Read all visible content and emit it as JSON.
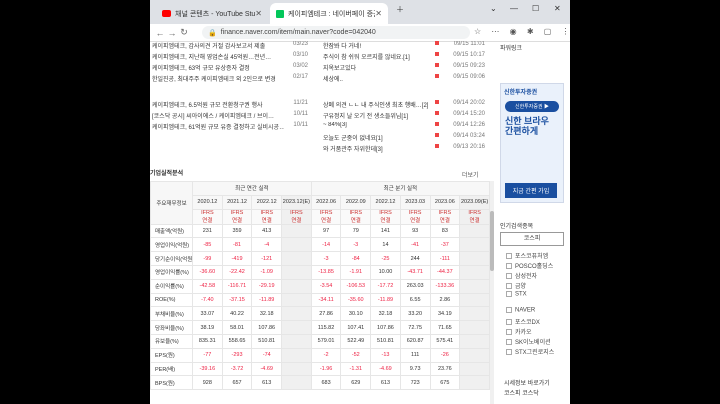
{
  "tabs": [
    {
      "label": "채널 콘텐츠 - YouTube Studio",
      "icon": "youtube-icon"
    },
    {
      "label": "케이피엠테크 : 네이버페이 증권",
      "icon": "naver-icon"
    }
  ],
  "address": "finance.naver.com/item/main.naver?code=042040",
  "news_left": [
    {
      "title": "케이피엠테크, 감사의견 거절 감사보고서 제출",
      "date": "03/23"
    },
    {
      "title": "케이피엠테크, 지난해 영업손실 45억원…전년…",
      "date": "03/10"
    },
    {
      "title": "케이피엠테크, 63억 규모 유상증자 결정",
      "date": "03/02"
    },
    {
      "title": "한일진공, 최대주주 케이피엠테크 외 2인으로 변경",
      "date": "02/17"
    },
    {
      "title": "케이피엠테크, 6.5억원 규모 전환청구권 행사",
      "date": "11/21"
    },
    {
      "title": "[코스닥 공시] 씨아이에스 / 케이피엠테크 / 브이…",
      "date": "10/11"
    },
    {
      "title": "케이피엠테크, 61억원 규모 유증 결정하고 실비시공…",
      "date": "10/11"
    }
  ],
  "news_right": [
    {
      "title": "한잠봐 다 거네!",
      "date": "09/15 11:01"
    },
    {
      "title": "주식이 참 쉬워 오르지를 않네요.[1]",
      "date": "09/15 10:17"
    },
    {
      "title": "지옥보고있다",
      "date": "09/15 09:23"
    },
    {
      "title": "세상에..",
      "date": "09/15 09:06"
    },
    {
      "title": "상폐 의견 ㄴㄴ 내 주식인생 최초 행배…[2]",
      "date": "09/14 20:02"
    },
    {
      "title": "구유정지 날 오기 전 생소들위님[1]",
      "date": "09/14 15:20"
    },
    {
      "title": "~ 84%[3]",
      "date": "09/14 12:26"
    },
    {
      "title": "오늘도 군중이 없네요[1]",
      "date": "09/14 03:24"
    },
    {
      "title": "와 거품관주 자위한데[3]",
      "date": "09/13 20:16"
    }
  ],
  "fin": {
    "title": "기업실적분석",
    "more": "더보기",
    "group_annual": "최근 연간 실적",
    "group_quarter": "최근 분기 실적",
    "row_header": "주요재무정보",
    "periods": [
      "2020.12",
      "2021.12",
      "2022.12",
      "2023.12(E)",
      "2022.06",
      "2022.09",
      "2022.12",
      "2023.03",
      "2023.06",
      "2023.09(E)"
    ],
    "ifrs": "IFRS",
    "ifrs_sub": "연결",
    "rows": [
      {
        "label": "매출액(억원)",
        "values": [
          "231",
          "359",
          "413",
          "",
          "97",
          "79",
          "141",
          "93",
          "83",
          ""
        ]
      },
      {
        "label": "영업이익(억원)",
        "values": [
          "-85",
          "-81",
          "-4",
          "",
          "-14",
          "-3",
          "14",
          "-41",
          "-37",
          ""
        ]
      },
      {
        "label": "당기순이익(억원)",
        "values": [
          "-99",
          "-419",
          "-121",
          "",
          "-3",
          "-84",
          "-25",
          "244",
          "-111",
          ""
        ]
      },
      {
        "label": "영업이익률(%)",
        "values": [
          "-36.60",
          "-22.42",
          "-1.09",
          "",
          "-13.85",
          "-1.91",
          "10.00",
          "-43.71",
          "-44.37",
          ""
        ]
      },
      {
        "label": "순이익률(%)",
        "values": [
          "-42.58",
          "-116.71",
          "-29.19",
          "",
          "-3.54",
          "-106.53",
          "-17.72",
          "263.03",
          "-133.36",
          ""
        ]
      },
      {
        "label": "ROE(%)",
        "values": [
          "-7.40",
          "-37.15",
          "-11.89",
          "",
          "-34.11",
          "-35.60",
          "-11.89",
          "6.55",
          "2.86",
          ""
        ]
      },
      {
        "label": "부채비율(%)",
        "values": [
          "33.07",
          "40.22",
          "32.18",
          "",
          "27.86",
          "30.10",
          "32.18",
          "33.20",
          "34.19",
          ""
        ]
      },
      {
        "label": "당좌비율(%)",
        "values": [
          "38.19",
          "58.01",
          "107.86",
          "",
          "115.82",
          "107.41",
          "107.86",
          "72.75",
          "71.65",
          ""
        ]
      },
      {
        "label": "유보율(%)",
        "values": [
          "835.31",
          "558.65",
          "510.81",
          "",
          "579.01",
          "522.49",
          "510.81",
          "620.87",
          "575.41",
          ""
        ]
      },
      {
        "label": "EPS(원)",
        "values": [
          "-77",
          "-293",
          "-74",
          "",
          "-2",
          "-52",
          "-13",
          "111",
          "-26",
          ""
        ]
      },
      {
        "label": "PER(배)",
        "values": [
          "-39.16",
          "-3.72",
          "-4.69",
          "",
          "-1.96",
          "-1.31",
          "-4.69",
          "9.73",
          "23.76",
          ""
        ]
      },
      {
        "label": "BPS(원)",
        "values": [
          "928",
          "657",
          "613",
          "",
          "683",
          "629",
          "613",
          "723",
          "675",
          ""
        ]
      }
    ]
  },
  "side": {
    "top_label": "파워링크",
    "ad_brand": "신한투자증권",
    "ad_pill": "신한투자증권 ▶",
    "ad_big": "신한 브라우\n간편하게",
    "ad_btn": "지금 간편 가입",
    "related_title": "인기검색종목",
    "tab_label": "코스피",
    "stocks": [
      "포스코퓨처엠",
      "POSCO홀딩스",
      "삼성전자",
      "금양",
      "STX",
      "NAVER",
      "포스코DX",
      "카카오",
      "SK이노베이션",
      "STX그린로지스"
    ],
    "bottom_title": "시세정보 바로가기",
    "bottom_links": "코스피  코스닥"
  }
}
